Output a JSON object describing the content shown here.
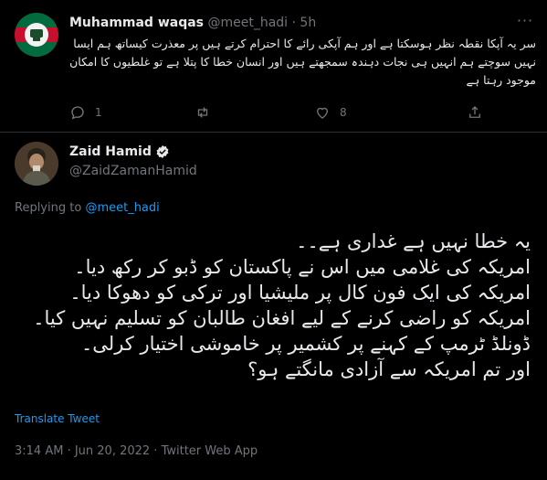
{
  "reply_tweet": {
    "display_name": "Muhammad waqas",
    "handle": "@meet_hadi",
    "separator": "·",
    "time": "5h",
    "text": "سر یہ آپکا نقطہ نظر ہوسکتا ہے اور ہم آپکی رائے کا احترام کرتے ہیں پر معذرت کیساتھ ہم ایسا نہیں سوچتے ہم انہیں ہی نجات دہندہ سمجھتے ہیں اور انسان خطا کا پتلا ہے تو غلطیوں کا امکان موجود رہتا ہے",
    "reply_count": "1",
    "retweet_count": "",
    "like_count": "8"
  },
  "main_tweet": {
    "display_name": "Zaid Hamid",
    "handle": "@ZaidZamanHamid",
    "replying_prefix": "Replying to",
    "replying_to": "@meet_hadi",
    "text": "یہ خطا نہیں ہے غداری ہے۔۔\nامریکہ کی غلامی میں اس نے پاکستان کو ڈبو کر رکھ دیا۔\nامریکہ کی ایک فون کال پر ملیشیا اور ترکی کو دھوکا دیا۔\nامریکہ کو راضی کرنے کے لیے افغان طالبان کو تسلیم نہیں کیا۔\nڈونلڈ ٹرمپ کے کہنے پر کشمیر پر خاموشی اختیار کرلی۔\nاور تم امریکہ سے آزادی مانگتے ہو؟",
    "translate_label": "Translate Tweet",
    "meta": "3:14 AM · Jun 20, 2022 · Twitter Web App"
  },
  "colors": {
    "background": "#000000",
    "text": "#e7e9ea",
    "muted": "#71767b",
    "link": "#1d9bf0",
    "divider": "#2f3336"
  }
}
